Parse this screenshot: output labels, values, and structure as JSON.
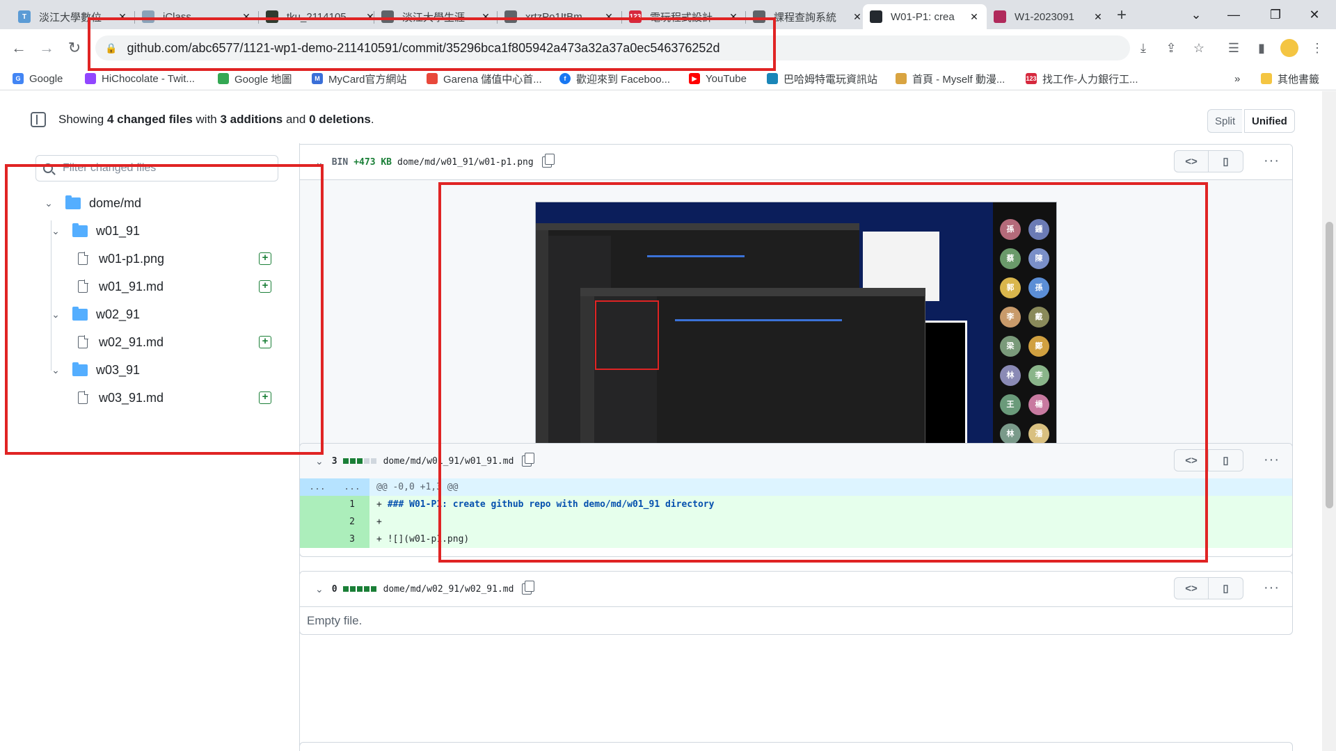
{
  "browser": {
    "tabs": [
      {
        "title": "淡江大學數位",
        "icon_color": "#5b9bd5",
        "icon_text": "T"
      },
      {
        "title": "iClass",
        "icon_color": "#8aa2b8",
        "icon_text": ""
      },
      {
        "title": "tku_2114105",
        "icon_color": "#2f3b2f",
        "icon_text": ""
      },
      {
        "title": "淡江大學生涯",
        "icon_color": "#5f6368",
        "icon_text": ""
      },
      {
        "title": "xrtzPo1ItBm",
        "icon_color": "#5f6368",
        "icon_text": ""
      },
      {
        "title": "電玩程式設計",
        "icon_color": "#d6293e",
        "icon_text": "123"
      },
      {
        "title": "課程查詢系統",
        "icon_color": "#5f6368",
        "icon_text": ""
      },
      {
        "title": "W01-P1: crea",
        "icon_color": "#24292f",
        "icon_text": ""
      },
      {
        "title": "W1-2023091",
        "icon_color": "#b02a5b",
        "icon_text": ""
      }
    ],
    "new_tab": "+",
    "window_controls": {
      "dropdown": "⌄",
      "minimize": "—",
      "restore": "❐",
      "close": "✕"
    },
    "url": "github.com/abc6577/1121-wp1-demo-211410591/commit/35296bca1f805942a473a32a37a0ec546376252d",
    "bookmarks": [
      {
        "label": "Google",
        "icon_color": "#4285f4",
        "icon_text": "G"
      },
      {
        "label": "HiChocolate - Twit...",
        "icon_color": "#9146ff",
        "icon_text": ""
      },
      {
        "label": "Google 地圖",
        "icon_color": "#34a853",
        "icon_text": ""
      },
      {
        "label": "MyCard官方網站",
        "icon_color": "#3a6fd8",
        "icon_text": "M"
      },
      {
        "label": "Garena 儲值中心首...",
        "icon_color": "#e8483b",
        "icon_text": ""
      },
      {
        "label": "歡迎來到 Faceboo...",
        "icon_color": "#1877f2",
        "icon_text": "f"
      },
      {
        "label": "YouTube",
        "icon_color": "#ff0000",
        "icon_text": "▶"
      },
      {
        "label": "巴哈姆特電玩資訊站",
        "icon_color": "#1a86b8",
        "icon_text": ""
      },
      {
        "label": "首頁 - Myself 動漫...",
        "icon_color": "#d9a441",
        "icon_text": ""
      },
      {
        "label": "找工作-人力銀行工...",
        "icon_color": "#d6293e",
        "icon_text": "123"
      }
    ],
    "bookmarks_more": "»",
    "other_bookmarks": "其他書籤"
  },
  "summary": {
    "prefix": "Showing ",
    "files": "4 changed files",
    "with": " with ",
    "additions": "3 additions",
    "and": " and ",
    "deletions": "0 deletions",
    "suffix": "."
  },
  "view_toggle": {
    "split": "Split",
    "unified": "Unified"
  },
  "filter": {
    "placeholder": "Filter changed files"
  },
  "tree": {
    "root": "dome/md",
    "folders": [
      {
        "name": "w01_91",
        "files": [
          "w01-p1.png",
          "w01_91.md"
        ]
      },
      {
        "name": "w02_91",
        "files": [
          "w02_91.md"
        ]
      },
      {
        "name": "w03_91",
        "files": [
          "w03_91.md"
        ]
      }
    ]
  },
  "diffs": [
    {
      "type": "BIN",
      "size": "+473 KB",
      "path": "dome/md/w01_91/w01-p1.png"
    },
    {
      "count": "3",
      "path": "dome/md/w01_91/w01_91.md",
      "hunk": "@@ -0,0 +1,3 @@",
      "hunk_dots": "...",
      "lines": [
        {
          "num": "1",
          "text": "### W01-P1: create github repo with demo/md/w01_91 directory"
        },
        {
          "num": "2",
          "text": ""
        },
        {
          "num": "3",
          "text": "![](w01-p1.png)"
        }
      ]
    },
    {
      "count": "0",
      "path": "dome/md/w02_91/w02_91.md",
      "empty": "Empty file."
    }
  ],
  "colors": {
    "annotation": "#e02424",
    "diff_add": "#1a7f37",
    "accent": "#0969da"
  }
}
